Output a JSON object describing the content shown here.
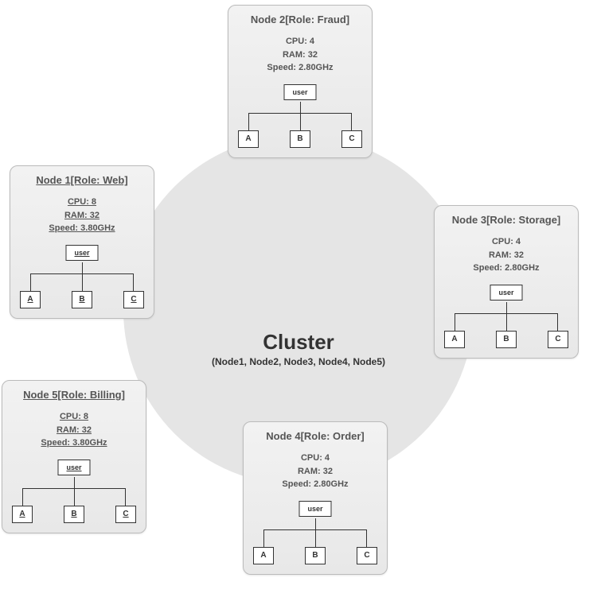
{
  "cluster": {
    "title": "Cluster",
    "subtitle": "(Node1, Node2, Node3, Node4, Node5)"
  },
  "nodes": {
    "node1": {
      "title": "Node 1[Role: Web]",
      "cpu": "CPU: 8",
      "ram": "RAM: 32",
      "speed": "Speed: 3.80GHz",
      "user": "user",
      "children": {
        "a": "A",
        "b": "B",
        "c": "C"
      }
    },
    "node2": {
      "title": "Node 2[Role: Fraud]",
      "cpu": "CPU: 4",
      "ram": "RAM: 32",
      "speed": "Speed: 2.80GHz",
      "user": "user",
      "children": {
        "a": "A",
        "b": "B",
        "c": "C"
      }
    },
    "node3": {
      "title": "Node 3[Role: Storage]",
      "cpu": "CPU: 4",
      "ram": "RAM: 32",
      "speed": "Speed: 2.80GHz",
      "user": "user",
      "children": {
        "a": "A",
        "b": "B",
        "c": "C"
      }
    },
    "node4": {
      "title": "Node 4[Role: Order]",
      "cpu": "CPU: 4",
      "ram": "RAM: 32",
      "speed": "Speed: 2.80GHz",
      "user": "user",
      "children": {
        "a": "A",
        "b": "B",
        "c": "C"
      }
    },
    "node5": {
      "title": "Node 5[Role: Billing]",
      "cpu": "CPU: 8",
      "ram": "RAM: 32",
      "speed": "Speed: 3.80GHz",
      "user": "user",
      "children": {
        "a": "A",
        "b": "B",
        "c": "C"
      }
    }
  }
}
